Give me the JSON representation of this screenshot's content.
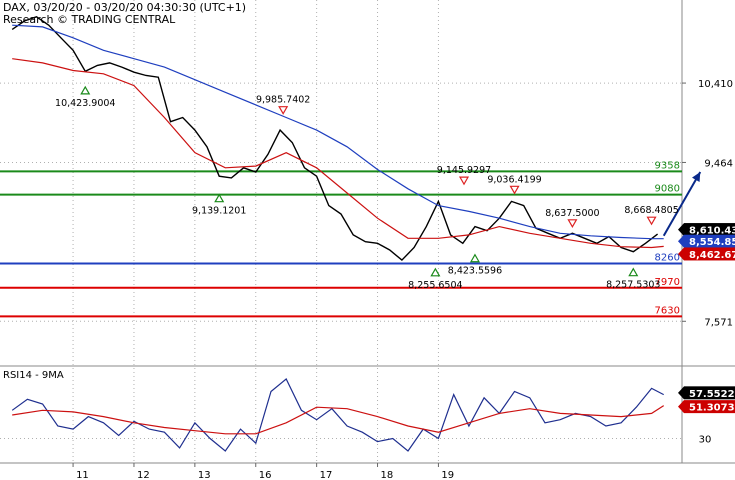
{
  "header": {
    "line1": "DAX, 03/20/20 - 03/20/20 04:30:30 (UTC+1)",
    "line2": "Research © TRADING CENTRAL"
  },
  "chart_data": [
    {
      "type": "line",
      "title": "",
      "instrument": "DAX",
      "ylim": [
        7050,
        11400
      ],
      "grid": true,
      "y_ticks": [
        "10,410",
        "9,464",
        "7,571"
      ],
      "y_tick_values": [
        10410,
        9464,
        7571
      ],
      "x_ticks": [
        "11",
        "12",
        "13",
        "16",
        "17",
        "18",
        "19"
      ],
      "current_price_labels": [
        {
          "text": "8,610.43",
          "value": 8610.43,
          "color": "#000000"
        },
        {
          "text": "8,554.85",
          "value": 8554.85,
          "color": "#1f3fbf"
        },
        {
          "text": "8,462.67",
          "value": 8462.67,
          "color": "#cc0000"
        }
      ],
      "levels": [
        {
          "label": "9358",
          "value": 9358,
          "color": "#1a8a1a",
          "role": "resistance"
        },
        {
          "label": "9080",
          "value": 9080,
          "color": "#1a8a1a",
          "role": "resistance"
        },
        {
          "label": "8260",
          "value": 8260,
          "color": "#1f3fbf",
          "role": "pivot"
        },
        {
          "label": "7970",
          "value": 7970,
          "color": "#dd0000",
          "role": "support"
        },
        {
          "label": "7630",
          "value": 7630,
          "color": "#dd0000",
          "role": "support"
        }
      ],
      "annotations": [
        {
          "text": "10,423.9004",
          "x": 1.2,
          "y": 10423.9,
          "kind": "low"
        },
        {
          "text": "9,985.7402",
          "x": 4.45,
          "y": 9985.74,
          "kind": "high"
        },
        {
          "text": "9,139.1201",
          "x": 3.4,
          "y": 9139.12,
          "kind": "low"
        },
        {
          "text": "9,145.9297",
          "x": 7.42,
          "y": 9145.93,
          "kind": "high"
        },
        {
          "text": "9,036.4199",
          "x": 8.25,
          "y": 9036.42,
          "kind": "high"
        },
        {
          "text": "8,637.5000",
          "x": 9.2,
          "y": 8637.5,
          "kind": "high"
        },
        {
          "text": "8,423.5596",
          "x": 7.6,
          "y": 8423.56,
          "kind": "low"
        },
        {
          "text": "8,255.6504",
          "x": 6.95,
          "y": 8255.65,
          "kind": "low"
        },
        {
          "text": "8,668.4805",
          "x": 10.5,
          "y": 8668.48,
          "kind": "high"
        },
        {
          "text": "8,257.5303",
          "x": 10.2,
          "y": 8257.53,
          "kind": "low"
        }
      ],
      "forecast_arrow": {
        "from": [
          10.7,
          8590
        ],
        "to": [
          11.3,
          9350
        ],
        "color": "#0a2a8a"
      },
      "series": [
        {
          "name": "",
          "color": "#000000",
          "x": [
            0,
            0.2,
            0.4,
            0.6,
            0.8,
            1.0,
            1.2,
            1.4,
            1.6,
            1.8,
            2.0,
            2.2,
            2.4,
            2.6,
            2.8,
            3.0,
            3.2,
            3.4,
            3.6,
            3.8,
            4.0,
            4.2,
            4.4,
            4.6,
            4.8,
            5.0,
            5.2,
            5.4,
            5.6,
            5.8,
            6.0,
            6.2,
            6.4,
            6.6,
            6.8,
            7.0,
            7.2,
            7.4,
            7.6,
            7.8,
            8.0,
            8.2,
            8.4,
            8.6,
            8.8,
            9.0,
            9.2,
            9.4,
            9.6,
            9.8,
            10.0,
            10.2,
            10.4,
            10.6
          ],
          "values": [
            11050,
            11150,
            11200,
            11100,
            10950,
            10800,
            10550,
            10620,
            10650,
            10600,
            10540,
            10500,
            10480,
            9950,
            10000,
            9850,
            9650,
            9300,
            9280,
            9400,
            9350,
            9560,
            9850,
            9700,
            9400,
            9300,
            8950,
            8850,
            8600,
            8520,
            8500,
            8420,
            8300,
            8450,
            8700,
            9000,
            8600,
            8500,
            8700,
            8650,
            8800,
            9000,
            8950,
            8680,
            8620,
            8560,
            8620,
            8560,
            8500,
            8580,
            8450,
            8400,
            8500,
            8610
          ]
        },
        {
          "name": "",
          "color": "#1f3fbf",
          "x": [
            0,
            0.5,
            1.0,
            1.5,
            2.0,
            2.5,
            3.0,
            3.5,
            4.0,
            4.5,
            5.0,
            5.5,
            6.0,
            6.5,
            7.0,
            7.5,
            8.0,
            8.5,
            9.0,
            9.5,
            10.0,
            10.5,
            10.7
          ],
          "values": [
            11100,
            11080,
            10950,
            10800,
            10700,
            10600,
            10450,
            10300,
            10150,
            10000,
            9850,
            9650,
            9380,
            9150,
            8950,
            8880,
            8800,
            8700,
            8620,
            8590,
            8570,
            8555,
            8555
          ]
        },
        {
          "name": "",
          "color": "#cc1111",
          "x": [
            0,
            0.5,
            1.0,
            1.5,
            2.0,
            2.5,
            3.0,
            3.5,
            4.0,
            4.5,
            5.0,
            5.5,
            6.0,
            6.5,
            7.0,
            7.5,
            8.0,
            8.5,
            9.0,
            9.5,
            10.0,
            10.5,
            10.7
          ],
          "values": [
            10700,
            10650,
            10560,
            10520,
            10380,
            10000,
            9580,
            9400,
            9420,
            9580,
            9400,
            9100,
            8800,
            8560,
            8560,
            8600,
            8700,
            8620,
            8560,
            8500,
            8460,
            8450,
            8463
          ]
        }
      ]
    },
    {
      "type": "line",
      "title": "RSI14 - 9MA",
      "ylim": [
        15,
        75
      ],
      "y_ticks": [
        "30"
      ],
      "y_tick_values": [
        30
      ],
      "current_value_labels": [
        {
          "text": "57.5522",
          "value": 57.5522,
          "color": "#000000"
        },
        {
          "text": "51.3073",
          "value": 51.3073,
          "color": "#cc0000"
        }
      ],
      "series": [
        {
          "name": "RSI14",
          "color": "#1f2f8f",
          "x": [
            0,
            0.25,
            0.5,
            0.75,
            1.0,
            1.25,
            1.5,
            1.75,
            2.0,
            2.25,
            2.5,
            2.75,
            3.0,
            3.25,
            3.5,
            3.75,
            4.0,
            4.25,
            4.5,
            4.75,
            5.0,
            5.25,
            5.5,
            5.75,
            6.0,
            6.25,
            6.5,
            6.75,
            7.0,
            7.25,
            7.5,
            7.75,
            8.0,
            8.25,
            8.5,
            8.75,
            9.0,
            9.25,
            9.5,
            9.75,
            10.0,
            10.25,
            10.5,
            10.7
          ],
          "values": [
            48,
            55,
            52,
            38,
            36,
            44,
            40,
            32,
            41,
            36,
            34,
            24,
            40,
            30,
            22,
            36,
            27,
            60,
            68,
            48,
            42,
            49,
            38,
            34,
            28,
            30,
            22,
            36,
            30,
            58,
            38,
            56,
            46,
            60,
            56,
            40,
            42,
            46,
            44,
            38,
            40,
            50,
            62,
            58
          ]
        },
        {
          "name": "9MA",
          "color": "#cc1111",
          "x": [
            0,
            0.5,
            1.0,
            1.5,
            2.0,
            2.5,
            3.0,
            3.5,
            4.0,
            4.5,
            5.0,
            5.5,
            6.0,
            6.5,
            7.0,
            7.5,
            8.0,
            8.5,
            9.0,
            9.5,
            10.0,
            10.5,
            10.7
          ],
          "values": [
            45,
            48,
            47,
            44,
            40,
            37,
            35,
            33,
            33,
            40,
            50,
            49,
            44,
            38,
            34,
            40,
            46,
            49,
            46,
            45,
            44,
            46,
            51
          ]
        }
      ]
    }
  ]
}
